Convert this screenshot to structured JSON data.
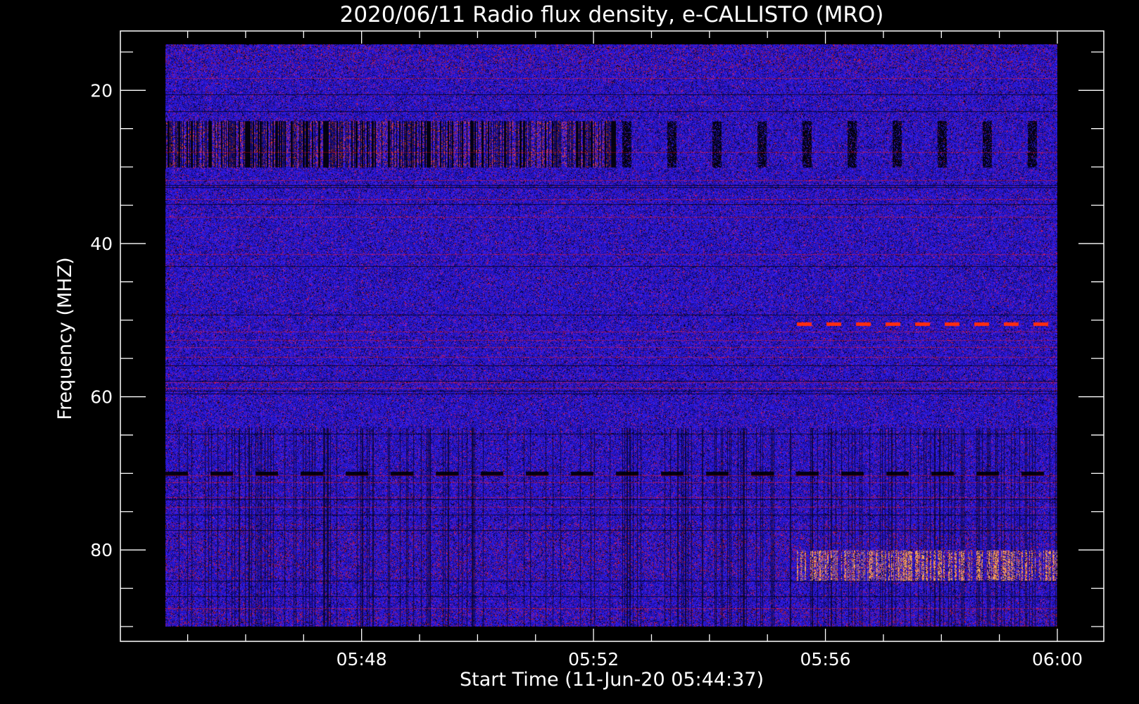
{
  "chart_data": {
    "type": "heatmap",
    "title": "2020/06/11  Radio flux density, e-CALLISTO (MRO)",
    "xlabel": "Start Time (11-Jun-20 05:44:37)",
    "ylabel": "Frequency (MHZ)",
    "x_ticks": [
      "05:48",
      "05:52",
      "05:56",
      "06:00"
    ],
    "x_range": [
      "05:44:37",
      "06:00"
    ],
    "y_ticks": [
      20,
      40,
      60,
      80
    ],
    "y_range": [
      14,
      90
    ],
    "y_inverted": true,
    "colors": {
      "background": "#000000",
      "base": "#1a10e6",
      "low": "#000000",
      "high": "#ff2a10"
    },
    "features": [
      {
        "kind": "dark-bursts",
        "freq_mhz": [
          24,
          30
        ],
        "time": [
          "05:44:37",
          "06:00"
        ]
      },
      {
        "kind": "red-dashes",
        "freq_mhz": 50.5,
        "time": [
          "05:55:30",
          "06:00"
        ]
      },
      {
        "kind": "dark-dashes",
        "freq_mhz": 70,
        "time": [
          "05:44:37",
          "06:00"
        ]
      },
      {
        "kind": "red-band",
        "freq_mhz": [
          80,
          84
        ],
        "time": [
          "05:55:30",
          "06:00"
        ]
      }
    ]
  }
}
